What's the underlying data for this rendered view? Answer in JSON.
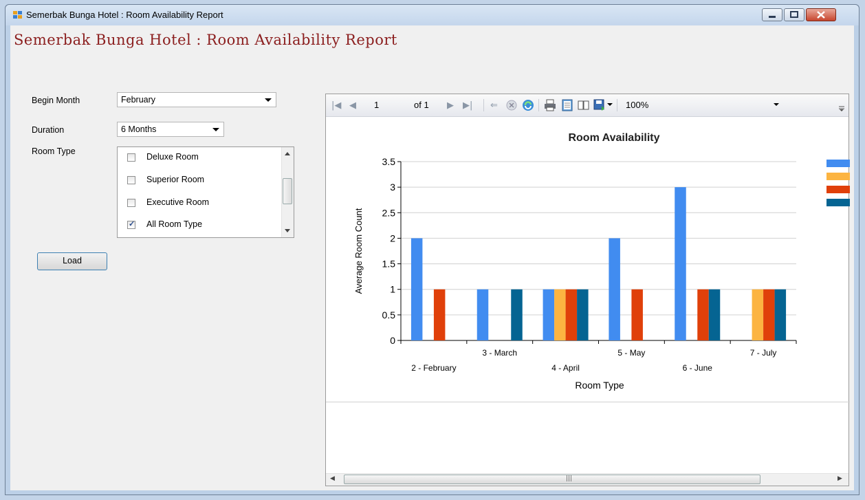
{
  "window": {
    "title": "Semerbak Bunga Hotel : Room Availability Report"
  },
  "header": {
    "title": "Semerbak Bunga Hotel : Room Availability Report"
  },
  "form": {
    "begin_month_label": "Begin Month",
    "begin_month_value": "February",
    "duration_label": "Duration",
    "duration_value": "6 Months",
    "room_type_label": "Room Type",
    "room_types": [
      {
        "label": "Deluxe Room",
        "checked": false
      },
      {
        "label": "Superior Room",
        "checked": false
      },
      {
        "label": "Executive Room",
        "checked": false
      },
      {
        "label": "All Room Type",
        "checked": true
      }
    ],
    "load_label": "Load"
  },
  "toolbar": {
    "page_value": "1",
    "of_label": "of 1",
    "zoom_value": "100%"
  },
  "colors": {
    "series_blue": "#418cf0",
    "series_yellow": "#fcb441",
    "series_red": "#e0400a",
    "series_teal": "#056492",
    "title_red": "#8b1e1e"
  },
  "chart_data": {
    "type": "bar",
    "title": "Room Availability",
    "xlabel": "Room Type",
    "ylabel": "Average Room Count",
    "ylim": [
      0,
      3.5
    ],
    "yticks": [
      "0",
      "0.5",
      "1",
      "1.5",
      "2",
      "2.5",
      "3",
      "3.5"
    ],
    "categories": [
      "2 - February",
      "3 - March",
      "4 - April",
      "5 - May",
      "6 - June",
      "7 - July"
    ],
    "series": [
      {
        "values": [
          2,
          1,
          1,
          2,
          3,
          0
        ]
      },
      {
        "values": [
          0,
          0,
          1,
          0,
          0,
          1
        ]
      },
      {
        "values": [
          1,
          0,
          1,
          1,
          1,
          1
        ]
      },
      {
        "values": [
          0,
          1,
          1,
          0,
          1,
          1
        ]
      }
    ],
    "legend": "right",
    "grid": true
  }
}
